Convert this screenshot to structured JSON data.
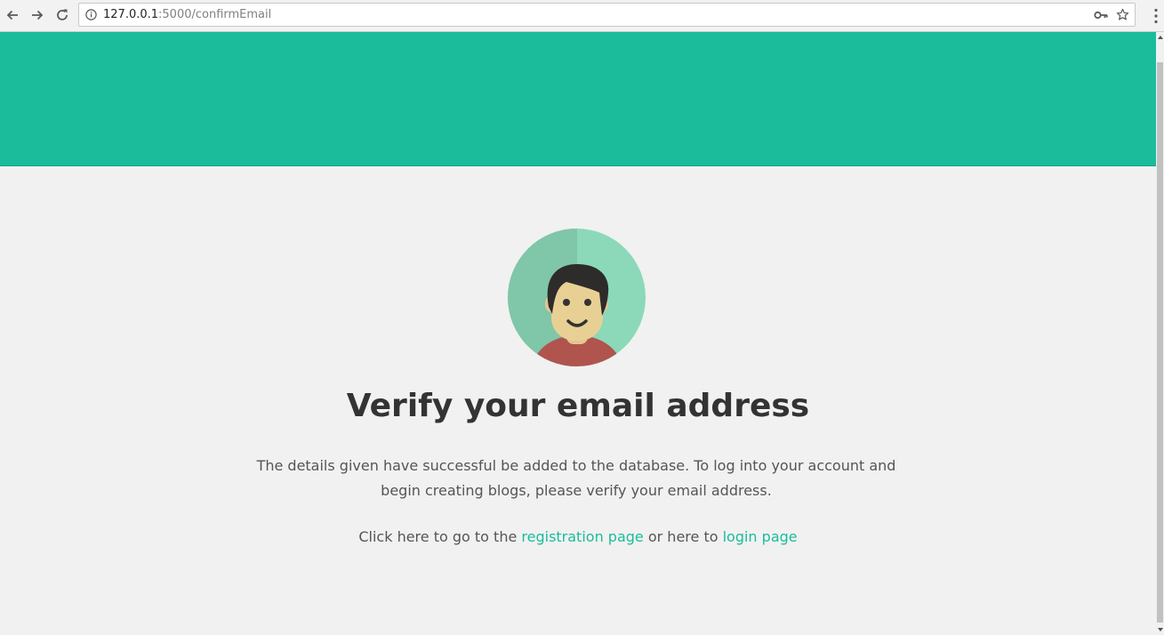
{
  "browser": {
    "url_host": "127.0.0.1",
    "url_path": ":5000/confirmEmail",
    "icons": {
      "back": "back-arrow-icon",
      "forward": "forward-arrow-icon",
      "reload": "reload-icon",
      "info": "info-icon",
      "key": "key-icon",
      "star": "star-icon",
      "menu": "kebab-menu-icon"
    }
  },
  "page": {
    "colors": {
      "accent": "#1bbc9b",
      "background": "#f1f1f1",
      "title": "#333333",
      "body_text": "#555555"
    },
    "avatar_icon": "user-avatar-icon",
    "title": "Verify your email address",
    "message": "The details given have successful be added to the database. To log into your account and begin creating blogs, please verify your email address.",
    "links": {
      "prefix": "Click here to go to the",
      "registration_label": "registration page",
      "middle": "or here to",
      "login_label": "login page"
    }
  }
}
